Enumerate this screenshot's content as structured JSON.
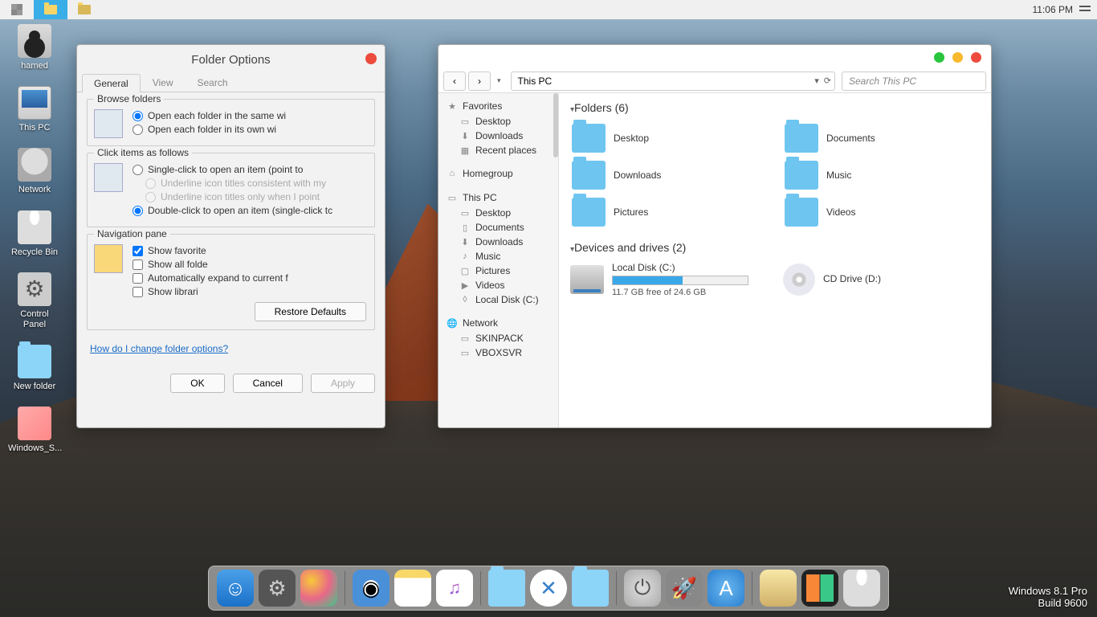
{
  "taskbar": {
    "clock": "11:06 PM"
  },
  "desktop": {
    "icons": [
      {
        "label": "hamed"
      },
      {
        "label": "This PC"
      },
      {
        "label": "Network"
      },
      {
        "label": "Recycle Bin"
      },
      {
        "label": "Control Panel"
      },
      {
        "label": "New folder"
      },
      {
        "label": "Windows_S..."
      }
    ]
  },
  "folder_options": {
    "title": "Folder Options",
    "tabs": {
      "general": "General",
      "view": "View",
      "search": "Search"
    },
    "browse": {
      "legend": "Browse folders",
      "same": "Open each folder in the same wi",
      "own": "Open each folder in its own wi"
    },
    "click": {
      "legend": "Click items as follows",
      "single": "Single-click to open an item (point to",
      "underline1": "Underline icon titles consistent with my",
      "underline2": "Underline icon titles only when I point",
      "double": "Double-click to open an item (single-click tc"
    },
    "nav": {
      "legend": "Navigation pane",
      "fav": "Show favorite",
      "all": "Show all folde",
      "auto": "Automatically expand to current f",
      "lib": "Show librari"
    },
    "restore": "Restore Defaults",
    "help_link": "How do I change folder options?",
    "ok": "OK",
    "cancel": "Cancel",
    "apply": "Apply"
  },
  "explorer": {
    "address": "This PC",
    "search_placeholder": "Search This PC",
    "sidebar": {
      "favorites": {
        "header": "Favorites",
        "items": [
          "Desktop",
          "Downloads",
          "Recent places"
        ]
      },
      "homegroup": {
        "header": "Homegroup"
      },
      "thispc": {
        "header": "This PC",
        "items": [
          "Desktop",
          "Documents",
          "Downloads",
          "Music",
          "Pictures",
          "Videos",
          "Local Disk (C:)"
        ]
      },
      "network": {
        "header": "Network",
        "items": [
          "SKINPACK",
          "VBOXSVR"
        ]
      }
    },
    "folders": {
      "header": "Folders (6)",
      "items": [
        "Desktop",
        "Documents",
        "Downloads",
        "Music",
        "Pictures",
        "Videos"
      ]
    },
    "drives": {
      "header": "Devices and drives (2)",
      "local": {
        "name": "Local Disk (C:)",
        "free": "11.7 GB free of 24.6 GB",
        "fill_pct": 52
      },
      "cd": {
        "name": "CD Drive (D:)"
      }
    }
  },
  "watermark": {
    "line1": "Windows 8.1 Pro",
    "line2": "Build 9600"
  }
}
